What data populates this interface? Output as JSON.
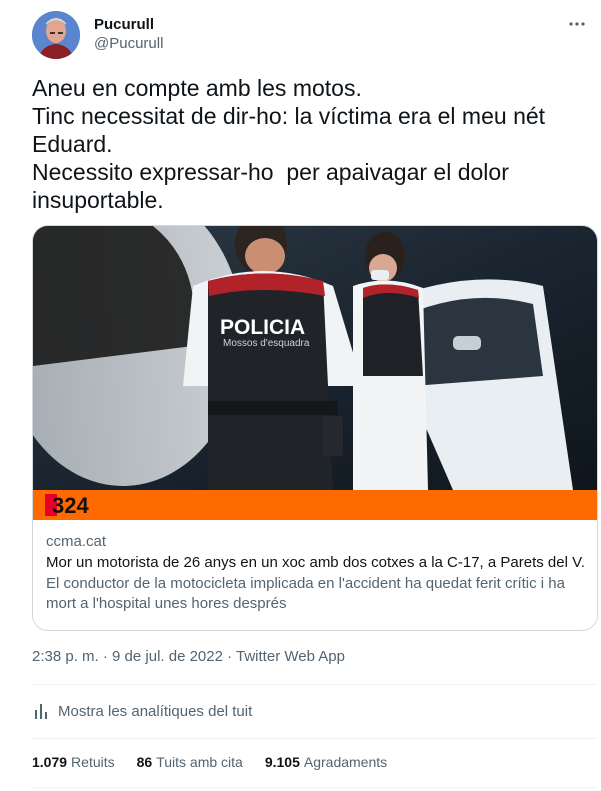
{
  "author": {
    "name": "Pucurull",
    "handle": "@Pucurull"
  },
  "tweet": {
    "lines": [
      "Aneu en compte amb les motos.",
      "Tinc necessitat de dir-ho: la víctima era el meu nét",
      "Eduard.",
      "Necessito expressar-ho  per apaivagar el dolor",
      "insuportable."
    ]
  },
  "card": {
    "image_vest_text": "POLICIA",
    "image_vest_subtext": "Mossos d'esquadra",
    "image_logo": "324",
    "domain": "ccma.cat",
    "title": "Mor un motorista de 26 anys en un xoc amb dos cotxes a la C-17, a Parets del V...",
    "description": "El conductor de la motocicleta implicada en l'accident ha quedat ferit crític i ha mort a l'hospital unes hores després"
  },
  "timestamp": "2:38 p. m. · 9 de jul. de 2022 · Twitter Web App",
  "analytics_label": "Mostra les analítiques del tuit",
  "stats": [
    {
      "value": "1.079",
      "label": "Retuits"
    },
    {
      "value": "86",
      "label": "Tuits amb cita"
    },
    {
      "value": "9.105",
      "label": "Agradaments"
    }
  ],
  "icons": {
    "more": "more-dots-icon",
    "analytics": "bar-chart-icon"
  },
  "colors": {
    "text_primary": "#0f1419",
    "text_secondary": "#536471",
    "border": "#cfd9de",
    "logo_orange": "#ff6a00"
  }
}
